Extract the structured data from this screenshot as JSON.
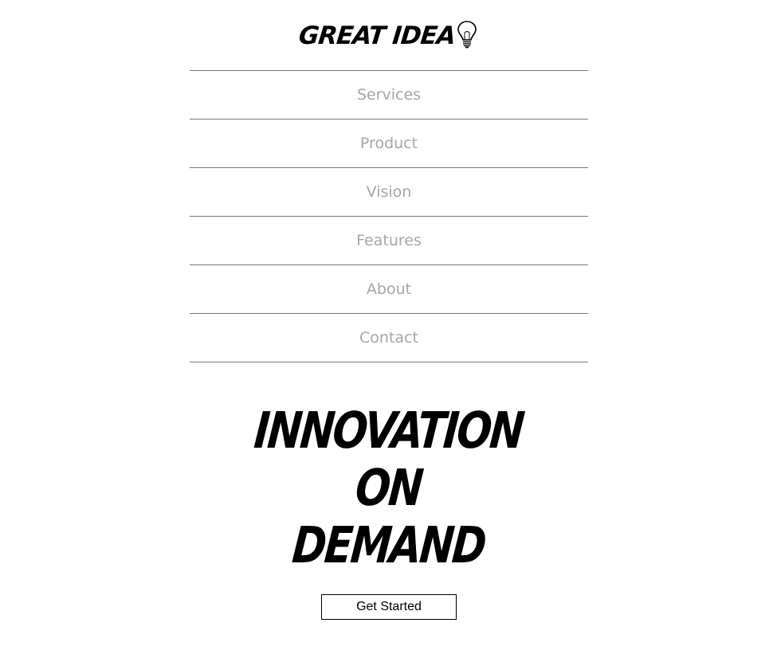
{
  "brand": {
    "name": "GREAT IDEA",
    "icon": "lightbulb-icon"
  },
  "nav": {
    "items": [
      {
        "label": "Services"
      },
      {
        "label": "Product"
      },
      {
        "label": "Vision"
      },
      {
        "label": "Features"
      },
      {
        "label": "About"
      },
      {
        "label": "Contact"
      }
    ]
  },
  "hero": {
    "lines": [
      "INNOVATION",
      "ON",
      "DEMAND"
    ]
  },
  "cta": {
    "label": "Get Started"
  },
  "colors": {
    "nav_text": "#a6a6a6",
    "divider": "#777777",
    "text": "#000000",
    "background": "#ffffff"
  }
}
